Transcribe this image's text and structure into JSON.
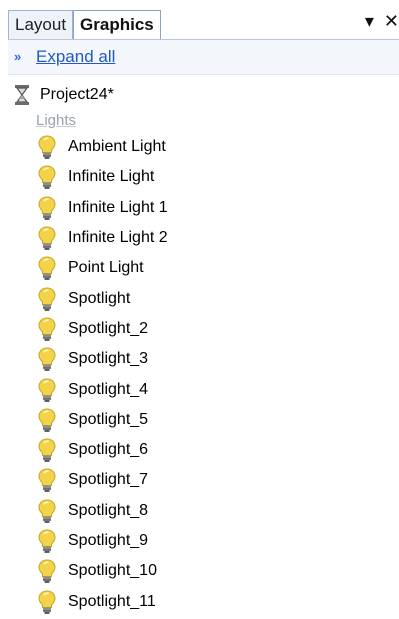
{
  "tabs": [
    {
      "label": "Layout",
      "active": false
    },
    {
      "label": "Graphics",
      "active": true
    }
  ],
  "controls": {
    "pin_icon": "pin-dropdown-icon",
    "close_icon": "close-icon",
    "pin_glyph": "▾",
    "close_glyph": "✕"
  },
  "toolbar": {
    "expand_glyph": "»",
    "expand_label": "Expand all"
  },
  "tree": {
    "project_label": "Project24*",
    "group_label": "Lights",
    "items": [
      {
        "label": "Ambient Light"
      },
      {
        "label": "Infinite Light"
      },
      {
        "label": "Infinite Light 1"
      },
      {
        "label": "Infinite Light 2"
      },
      {
        "label": "Point Light"
      },
      {
        "label": "Spotlight"
      },
      {
        "label": "Spotlight_2"
      },
      {
        "label": "Spotlight_3"
      },
      {
        "label": "Spotlight_4"
      },
      {
        "label": "Spotlight_5"
      },
      {
        "label": "Spotlight_6"
      },
      {
        "label": "Spotlight_7"
      },
      {
        "label": "Spotlight_8"
      },
      {
        "label": "Spotlight_9"
      },
      {
        "label": "Spotlight_10"
      },
      {
        "label": "Spotlight_11"
      }
    ]
  },
  "colors": {
    "accent": "#2359c4",
    "bulb": "#f3d34a",
    "tab_border": "#9fb4cf"
  }
}
